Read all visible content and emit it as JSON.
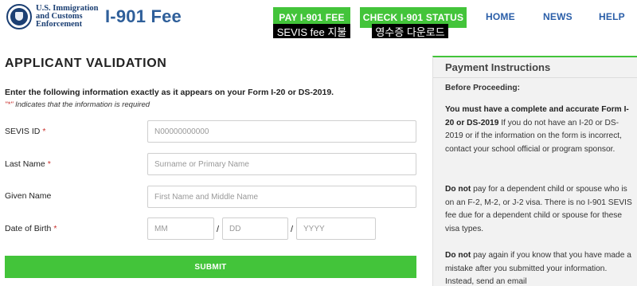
{
  "header": {
    "agency_lines": [
      "U.S. Immigration",
      "and Customs",
      "Enforcement"
    ],
    "site_title": "I-901 Fee",
    "pay_button": "PAY I-901 FEE",
    "check_button": "CHECK I-901 STATUS",
    "pay_tag": "SEVIS fee 지불",
    "check_tag": "영수증 다운로드",
    "nav": {
      "home": "HOME",
      "news": "NEWS",
      "help": "HELP"
    }
  },
  "form": {
    "title": "APPLICANT VALIDATION",
    "intro": "Enter the following information exactly as it appears on your Form I-20 or DS-2019.",
    "required_note_star": "\"*\"",
    "required_note_text": " Indicates that the information is required",
    "sevis": {
      "label": "SEVIS ID",
      "star": "*",
      "placeholder": "N00000000000",
      "value": ""
    },
    "last_name": {
      "label": "Last Name",
      "star": "*",
      "placeholder": "Surname or Primary Name",
      "value": ""
    },
    "given_name": {
      "label": "Given Name",
      "placeholder": "First Name and Middle Name",
      "value": ""
    },
    "dob": {
      "label": "Date of Birth",
      "star": "*",
      "mm_placeholder": "MM",
      "dd_placeholder": "DD",
      "yyyy_placeholder": "YYYY",
      "separator": "/"
    },
    "submit_label": "SUBMIT"
  },
  "panel": {
    "title": "Payment Instructions",
    "subtitle": "Before Proceeding:",
    "p1_bold": "You must have a complete and accurate Form I-20 or DS-2019",
    "p1_text": " If you do not have an I-20 or DS-2019 or if the information on the form is incorrect, contact your school official or program sponsor.",
    "p2_bold": "Do not",
    "p2_text": " pay for a dependent child or spouse who is on an F-2, M-2, or J-2 visa. There is no I-901 SEVIS fee due for a dependent child or spouse for these visa types.",
    "p3_bold": "Do not",
    "p3_text": " pay again if you know that you have made a mistake after you submitted your information. Instead, send an email"
  },
  "colors": {
    "accent_green": "#43c43a",
    "brand_blue": "#2f5f9a",
    "nav_blue": "#2a5ea8",
    "required_red": "#c9302c"
  }
}
